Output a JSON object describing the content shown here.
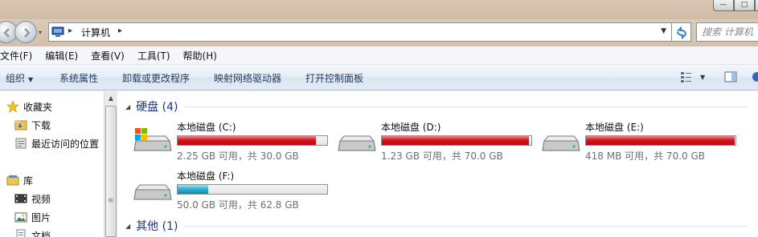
{
  "window": {
    "min_glyph": "—",
    "max_glyph": "□"
  },
  "address": {
    "crumb": "计算机",
    "separator": "▸",
    "search_placeholder": "搜索 计算机"
  },
  "menu": [
    "文件(F)",
    "编辑(E)",
    "查看(V)",
    "工具(T)",
    "帮助(H)"
  ],
  "commands": {
    "organize": "组织",
    "system_properties": "系统属性",
    "uninstall": "卸载或更改程序",
    "map_drive": "映射网络驱动器",
    "control_panel": "打开控制面板"
  },
  "nav": {
    "favorites": "收藏夹",
    "downloads": "下载",
    "recent": "最近访问的位置",
    "libraries": "库",
    "videos": "视频",
    "pictures": "图片",
    "documents": "文档"
  },
  "groups": {
    "hard_disks": "硬盘 (4)",
    "other": "其他 (1)"
  },
  "drives": [
    {
      "name": "本地磁盘 (C:)",
      "free": "2.25 GB 可用，共 30.0 GB",
      "used_fraction": 0.925,
      "bar_color": "red",
      "system": true
    },
    {
      "name": "本地磁盘 (D:)",
      "free": "1.23 GB 可用，共 70.0 GB",
      "used_fraction": 0.982,
      "bar_color": "red",
      "system": false
    },
    {
      "name": "本地磁盘 (E:)",
      "free": "418 MB 可用，共 70.0 GB",
      "used_fraction": 0.994,
      "bar_color": "red",
      "system": false
    },
    {
      "name": "本地磁盘 (F:)",
      "free": "50.0 GB 可用，共 62.8 GB",
      "used_fraction": 0.204,
      "bar_color": "blue",
      "system": false
    }
  ],
  "colors": {
    "group_title": "#1e3287",
    "bar_red": "#d4141c",
    "bar_blue": "#2fb2d3",
    "command_text": "#1e395b"
  }
}
